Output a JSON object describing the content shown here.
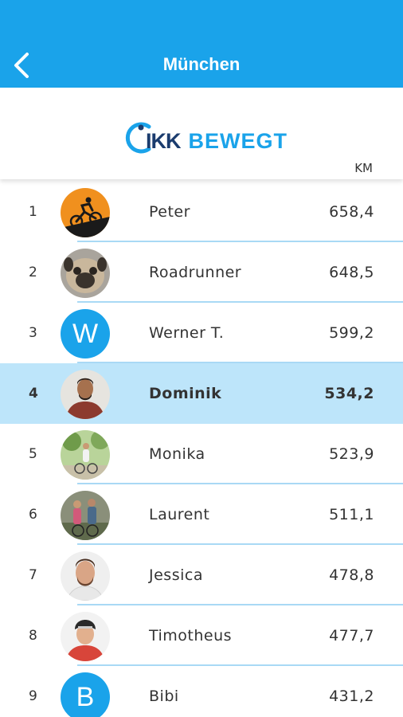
{
  "header": {
    "title": "München",
    "back_icon": "chevron-left-icon"
  },
  "logo": {
    "part1": "IKK",
    "part2": "BEWEGT"
  },
  "column_header": "KM",
  "colors": {
    "brand": "#1aa3ea",
    "highlight_row": "#bde5fa",
    "logo_dark": "#1b3c6e"
  },
  "leaderboard": [
    {
      "rank": "1",
      "name": "Peter",
      "km": "658,4",
      "avatar": "cyclist-silhouette"
    },
    {
      "rank": "2",
      "name": "Roadrunner",
      "km": "648,5",
      "avatar": "pug-photo"
    },
    {
      "rank": "3",
      "name": "Werner T.",
      "km": "599,2",
      "avatar": "letter",
      "letter": "W"
    },
    {
      "rank": "4",
      "name": "Dominik",
      "km": "534,2",
      "avatar": "man-photo",
      "highlighted": true
    },
    {
      "rank": "5",
      "name": "Monika",
      "km": "523,9",
      "avatar": "woman-bike-photo"
    },
    {
      "rank": "6",
      "name": "Laurent",
      "km": "511,1",
      "avatar": "couple-bike-photo"
    },
    {
      "rank": "7",
      "name": "Jessica",
      "km": "478,8",
      "avatar": "man-portrait-photo"
    },
    {
      "rank": "8",
      "name": "Timotheus",
      "km": "477,7",
      "avatar": "helmet-man-photo"
    },
    {
      "rank": "9",
      "name": "Bibi",
      "km": "431,2",
      "avatar": "letter",
      "letter": "B"
    }
  ]
}
